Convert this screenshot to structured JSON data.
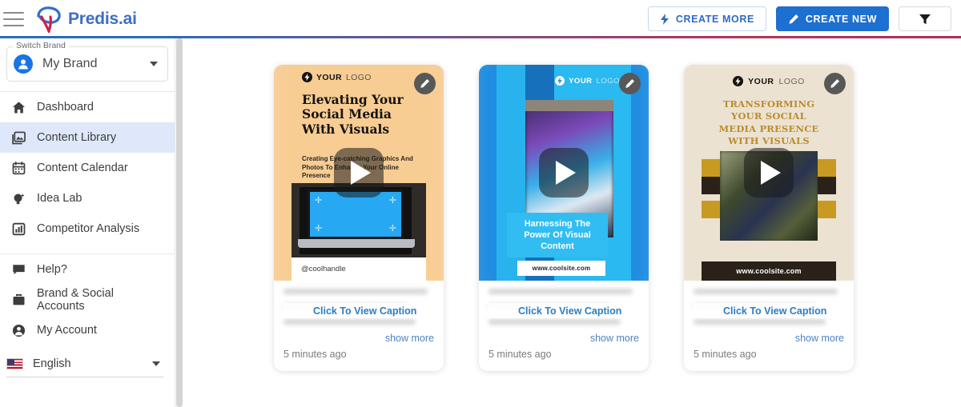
{
  "header": {
    "menu_icon": "hamburger-icon",
    "logo_icon": "predis-logo-icon",
    "brand_name": "Predis.ai",
    "buttons": {
      "create_more": {
        "label": "CREATE MORE",
        "icon": "bolt-icon"
      },
      "create_new": {
        "label": "CREATE NEW",
        "icon": "pencil-icon"
      },
      "filter": {
        "icon": "filter-icon",
        "label": ""
      }
    },
    "rule_gradient_from": "#2d6cb5",
    "rule_gradient_to": "#ad3159"
  },
  "sidebar": {
    "brand_switch": {
      "legend": "Switch Brand",
      "value": "My Brand",
      "avatar_icon": "user-avatar-icon",
      "chevron_icon": "chevron-down-icon"
    },
    "items": [
      {
        "label": "Dashboard",
        "icon": "home-icon",
        "active": false
      },
      {
        "label": "Content Library",
        "icon": "image-icon",
        "active": true
      },
      {
        "label": "Content Calendar",
        "icon": "calendar-icon",
        "active": false
      },
      {
        "label": "Idea Lab",
        "icon": "lightbulb-icon",
        "active": false
      },
      {
        "label": "Competitor Analysis",
        "icon": "bar-chart-icon",
        "active": false
      }
    ],
    "secondary_items": [
      {
        "label": "Help?",
        "icon": "chat-bubble-icon"
      },
      {
        "label": "Brand & Social Accounts",
        "icon": "briefcase-icon"
      },
      {
        "label": "My Account",
        "icon": "person-circle-icon"
      }
    ],
    "language": {
      "label": "English",
      "flag_icon": "us-flag-icon",
      "chevron_icon": "chevron-down-icon"
    },
    "active_highlight_color": "#dfe8fa"
  },
  "main": {
    "cards": [
      {
        "edit_icon": "pencil-icon",
        "play_icon": "play-icon",
        "creative": {
          "logo_text_bold": "YOUR",
          "logo_text_light": "LOGO",
          "logo_icon": "bolt-badge-icon",
          "title": "Elevating Your\nSocial Media\nWith Visuals",
          "subtitle": "Creating Eye-catching Graphics And Photos To Enhance Your Online Presence",
          "handle": "@coolhandle",
          "bg_color": "#f7cd94"
        },
        "caption_link": "Click To View Caption",
        "show_more": "show more",
        "timestamp": "5 minutes ago"
      },
      {
        "edit_icon": "pencil-icon",
        "play_icon": "play-icon",
        "creative": {
          "logo_text_bold": "YOUR",
          "logo_text_light": "LOGO",
          "logo_icon": "bolt-badge-icon",
          "overlay_caption": "Harnessing The Power Of Visual Content",
          "website": "www.coolsite.com",
          "bg_color": "#1f8de0"
        },
        "caption_link": "Click To View Caption",
        "show_more": "show more",
        "timestamp": "5 minutes ago"
      },
      {
        "edit_icon": "pencil-icon",
        "play_icon": "play-icon",
        "creative": {
          "logo_text_bold": "YOUR",
          "logo_text_light": "LOGO",
          "logo_icon": "bolt-badge-icon",
          "title": "TRANSFORMING YOUR SOCIAL MEDIA PRESENCE WITH VISUALS",
          "website": "www.coolsite.com",
          "bg_color": "#ece2d2"
        },
        "caption_link": "Click To View Caption",
        "show_more": "show more",
        "timestamp": "5 minutes ago"
      }
    ]
  }
}
